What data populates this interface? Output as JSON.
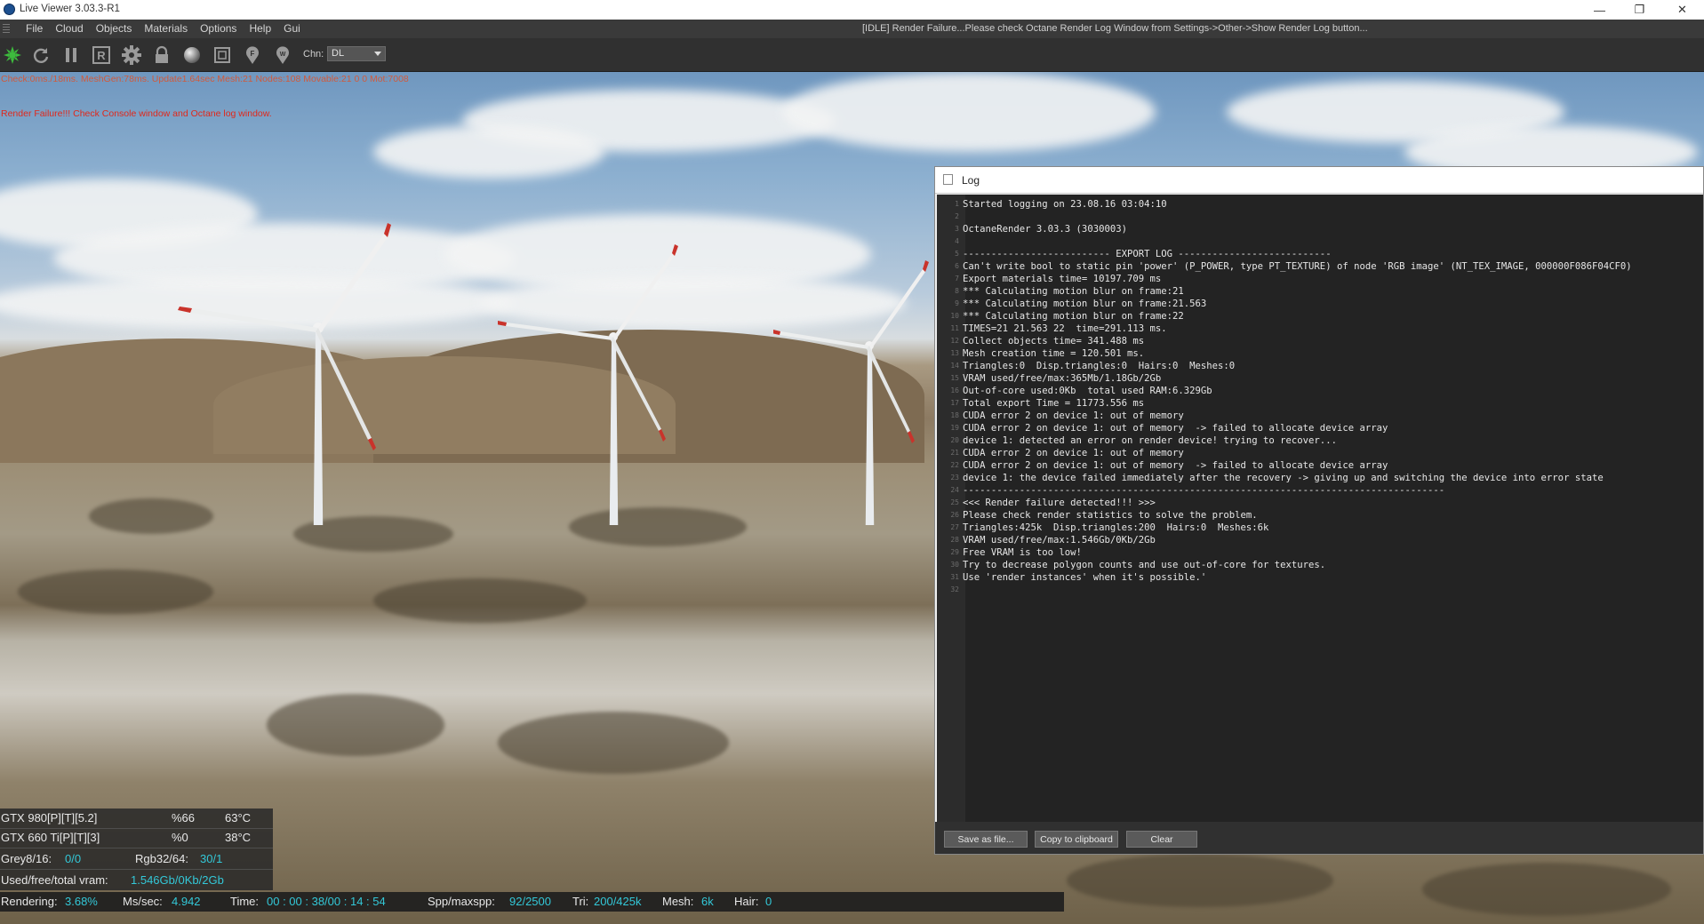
{
  "window": {
    "title": "Live Viewer 3.03.3-R1",
    "minimize": "—",
    "restore": "❐",
    "close": "✕"
  },
  "menu": {
    "items": [
      "File",
      "Cloud",
      "Objects",
      "Materials",
      "Options",
      "Help",
      "Gui"
    ],
    "status": "[IDLE] Render Failure...Please check Octane Render Log Window from Settings->Other->Show Render Log button..."
  },
  "toolbar": {
    "icons": [
      "octane-logo-icon",
      "refresh-icon",
      "pause-icon",
      "region-render-icon",
      "settings-gear-icon",
      "lock-icon",
      "material-ball-icon",
      "clay-mode-icon",
      "pick-focus-icon",
      "pick-white-balance-icon"
    ],
    "channel_label": "Chn:",
    "channel_value": "DL"
  },
  "overlay": {
    "info": "Check:0ms./18ms. MeshGen:78ms. Update1.64sec Mesh:21 Nodes:108 Movable:21  0 0 Mot:7008",
    "error": "Render Failure!!! Check Console window and Octane log window."
  },
  "log": {
    "title": "Log",
    "lines": [
      "Started logging on 23.08.16 03:04:10",
      "",
      "OctaneRender 3.03.3 (3030003)",
      "",
      "-------------------------- EXPORT LOG ---------------------------",
      "Can't write bool to static pin 'power' (P_POWER, type PT_TEXTURE) of node 'RGB image' (NT_TEX_IMAGE, 000000F086F04CF0)",
      "Export materials time= 10197.709 ms",
      "*** Calculating motion blur on frame:21",
      "*** Calculating motion blur on frame:21.563",
      "*** Calculating motion blur on frame:22",
      "TIMES=21 21.563 22  time=291.113 ms.",
      "Collect objects time= 341.488 ms",
      "Mesh creation time = 120.501 ms.",
      "Triangles:0  Disp.triangles:0  Hairs:0  Meshes:0",
      "VRAM used/free/max:365Mb/1.18Gb/2Gb",
      "Out-of-core used:0Kb  total used RAM:6.329Gb",
      "Total export Time = 11773.556 ms",
      "CUDA error 2 on device 1: out of memory",
      "CUDA error 2 on device 1: out of memory  -> failed to allocate device array",
      "device 1: detected an error on render device! trying to recover...",
      "CUDA error 2 on device 1: out of memory",
      "CUDA error 2 on device 1: out of memory  -> failed to allocate device array",
      "device 1: the device failed immediately after the recovery -> giving up and switching the device into error state",
      "-------------------------------------------------------------------------------------",
      "<<< Render failure detected!!! >>>",
      "Please check render statistics to solve the problem.",
      "Triangles:425k  Disp.triangles:200  Hairs:0  Meshes:6k",
      "VRAM used/free/max:1.546Gb/0Kb/2Gb",
      "Free VRAM is too low!",
      "Try to decrease polygon counts and use out-of-core for textures.",
      "Use 'render instances' when it's possible.'",
      ""
    ],
    "buttons": {
      "save": "Save as file...",
      "copy": "Copy to clipboard",
      "clear": "Clear"
    }
  },
  "gpu": {
    "row1": {
      "name": "GTX 980[P][T][5.2]",
      "util": "%66",
      "temp": "63°C"
    },
    "row2": {
      "name": "GTX 660 Ti[P][T][3]",
      "util": "%0",
      "temp": "38°C"
    },
    "grey_label": "Grey8/16:",
    "grey_value": "0/0",
    "rgb_label": "Rgb32/64:",
    "rgb_value": "30/1",
    "vram_label": "Used/free/total vram:",
    "vram_value": "1.546Gb/0Kb/2Gb"
  },
  "render": {
    "rendering_label": "Rendering:",
    "rendering_value": "3.68%",
    "mss_label": "Ms/sec:",
    "mss_value": "4.942",
    "time_label": "Time:",
    "time_value": "00 : 00 : 38/00 : 14 : 54",
    "spp_label": "Spp/maxspp:",
    "spp_value": "92/2500",
    "tri_label": "Tri:",
    "tri_value": "200/425k",
    "mesh_label": "Mesh:",
    "mesh_value": "6k",
    "hair_label": "Hair:",
    "hair_value": "0"
  },
  "colors": {
    "accent_cyan": "#33c8d8",
    "error_red": "#e0281a",
    "info_orange": "#d05a3c"
  }
}
